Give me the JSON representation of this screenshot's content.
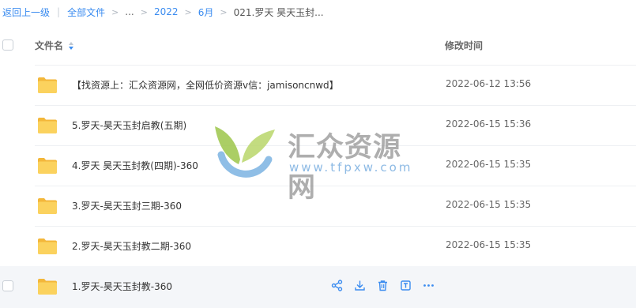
{
  "breadcrumb": {
    "back": "返回上一级",
    "all_files": "全部文件",
    "ellipsis": "...",
    "year": "2022",
    "month": "6月",
    "current": "021.罗天 昊天玉封..."
  },
  "table": {
    "col_name": "文件名",
    "col_time": "修改时间",
    "rows": [
      {
        "name": "【找资源上：汇众资源网，全网低价资源v信：jamisoncnwd】",
        "time": "2022-06-12 13:56"
      },
      {
        "name": "5.罗天-昊天玉封启教(五期)",
        "time": "2022-06-15 15:36"
      },
      {
        "name": "4.罗天 昊天玉封教(四期)-360",
        "time": "2022-06-15 15:35"
      },
      {
        "name": "3.罗天-昊天玉封三期-360",
        "time": "2022-06-15 15:35"
      },
      {
        "name": "2.罗天-昊天玉封教二期-360",
        "time": "2022-06-15 15:35"
      },
      {
        "name": "1.罗天-昊天玉封教-360",
        "time": ""
      }
    ]
  },
  "row_actions": [
    "share-icon",
    "download-icon",
    "delete-icon",
    "rename-icon",
    "more-icon"
  ],
  "watermark": {
    "title": "汇众资源网",
    "url": "www.tfpxw.com"
  },
  "colors": {
    "link": "#3b8cf0",
    "folder": "#f7c94b",
    "action_icon": "#3b8cf0",
    "hover_row": "#f4f6f9"
  }
}
